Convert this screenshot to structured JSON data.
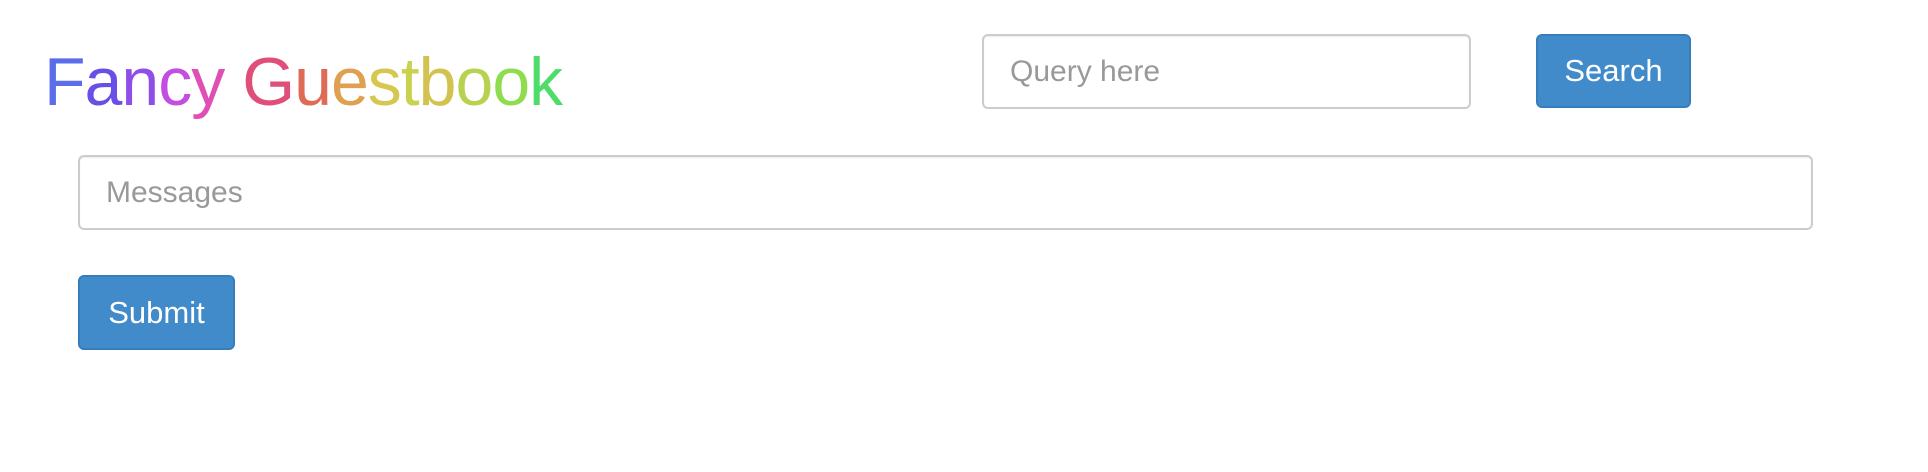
{
  "header": {
    "title": "Fancy Guestbook",
    "title_colors": [
      "#5b6de8",
      "#6a4fe6",
      "#8f4fe6",
      "#c24fe0",
      "#e04fb6",
      "#ffffff",
      "#df4f7a",
      "#df6a55",
      "#dfa04f",
      "#d6c84f",
      "#c9d24f",
      "#d2c24f",
      "#b7d24f",
      "#8fdd4f",
      "#4fdd6a"
    ]
  },
  "search": {
    "placeholder": "Query here",
    "value": "",
    "button_label": "Search"
  },
  "form": {
    "messages_placeholder": "Messages",
    "messages_value": "",
    "submit_label": "Submit"
  },
  "colors": {
    "button_bg": "#428bca",
    "button_border": "#357ebd",
    "input_border": "#cccccc",
    "placeholder": "#999999"
  }
}
